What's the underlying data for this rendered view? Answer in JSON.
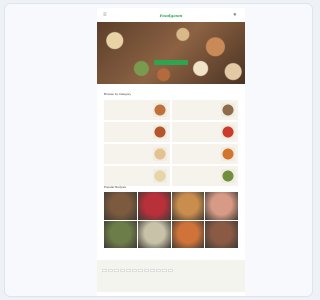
{
  "app": {
    "logo": "Foodgasm"
  },
  "hero": {
    "title": "",
    "subtitle": "",
    "cta": ""
  },
  "categories": {
    "title": "Browse by Category",
    "items": [
      {
        "label": "",
        "color": "#c0703a"
      },
      {
        "label": "",
        "color": "#8e6b4a"
      },
      {
        "label": "",
        "color": "#b5552c"
      },
      {
        "label": "",
        "color": "#cc3a2a"
      },
      {
        "label": "",
        "color": "#e2c28f"
      },
      {
        "label": "",
        "color": "#d2752f"
      },
      {
        "label": "",
        "color": "#e6d5a8"
      },
      {
        "label": "",
        "color": "#6f8f3f"
      }
    ]
  },
  "popular": {
    "title": "Popular Recipes",
    "items": [
      {
        "label": "",
        "color": "#7b5a3e"
      },
      {
        "label": "",
        "color": "#b8303a"
      },
      {
        "label": "",
        "color": "#c98d4e"
      },
      {
        "label": "",
        "color": "#d79a86"
      },
      {
        "label": "",
        "color": "#6d7d4a"
      },
      {
        "label": "",
        "color": "#c7c2a8"
      },
      {
        "label": "",
        "color": "#d0733a"
      },
      {
        "label": "",
        "color": "#8a5a45"
      }
    ]
  },
  "tags": {
    "title": "",
    "items": [
      "",
      "",
      "",
      "",
      "",
      "",
      "",
      "",
      "",
      "",
      "",
      ""
    ]
  },
  "footer": {
    "title": ""
  }
}
